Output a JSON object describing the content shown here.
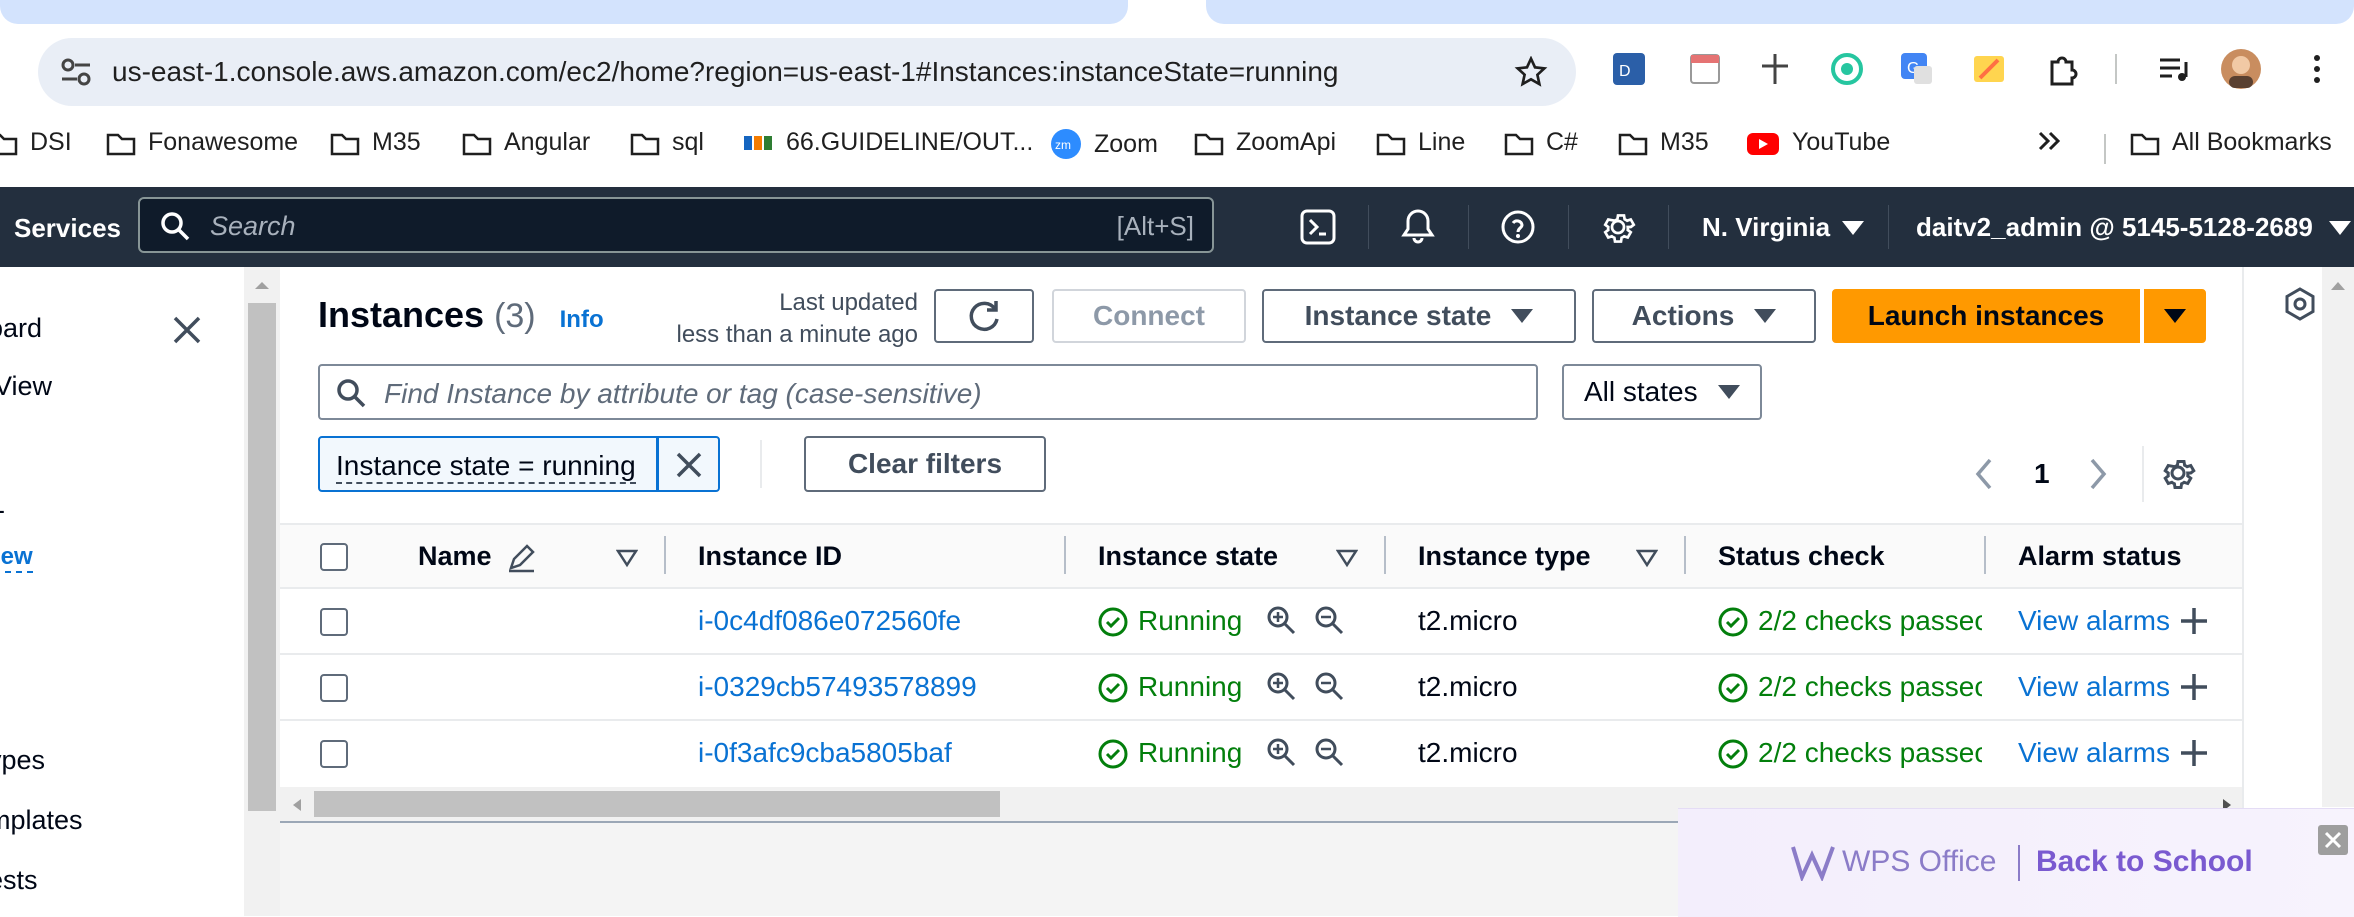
{
  "browser": {
    "url": "us-east-1.console.aws.amazon.com/ec2/home?region=us-east-1#Instances:instanceState=running",
    "bookmarks": [
      "DSI",
      "Fonawesome",
      "M35",
      "Angular",
      "sql",
      "66.GUIDELINE/OUT...",
      "Zoom",
      "ZoomApi",
      "Line",
      "C#",
      "M35",
      "YouTube"
    ],
    "all_bookmarks": "All Bookmarks"
  },
  "awsnav": {
    "services": "Services",
    "search_placeholder": "Search",
    "search_shortcut": "[Alt+S]",
    "region": "N. Virginia",
    "account": "daitv2_admin @ 5145-5128-2689"
  },
  "sidenav": {
    "items": [
      "oard",
      "View",
      "-",
      "iew",
      "ypes",
      "mplates",
      "ests"
    ]
  },
  "instances": {
    "title": "Instances",
    "count": "(3)",
    "info": "Info",
    "last_updated_1": "Last updated",
    "last_updated_2": "less than a minute ago",
    "connect": "Connect",
    "instance_state": "Instance state",
    "actions": "Actions",
    "launch": "Launch instances",
    "search_placeholder": "Find Instance by attribute or tag (case-sensitive)",
    "states_filter": "All states",
    "filter_token": "Instance state = running",
    "clear_filters": "Clear filters",
    "page": "1",
    "columns": [
      "Name",
      "Instance ID",
      "Instance state",
      "Instance type",
      "Status check",
      "Alarm status"
    ],
    "rows": [
      {
        "id": "i-0c4df086e072560fe",
        "state": "Running",
        "type": "t2.micro",
        "status": "2/2 checks passec",
        "alarm": "View alarms"
      },
      {
        "id": "i-0329cb57493578899",
        "state": "Running",
        "type": "t2.micro",
        "status": "2/2 checks passec",
        "alarm": "View alarms"
      },
      {
        "id": "i-0f3afc9cba5805baf",
        "state": "Running",
        "type": "t2.micro",
        "status": "2/2 checks passec",
        "alarm": "View alarms"
      }
    ]
  },
  "wps": {
    "brand": "WPS Office",
    "slogan": "Back to School"
  }
}
